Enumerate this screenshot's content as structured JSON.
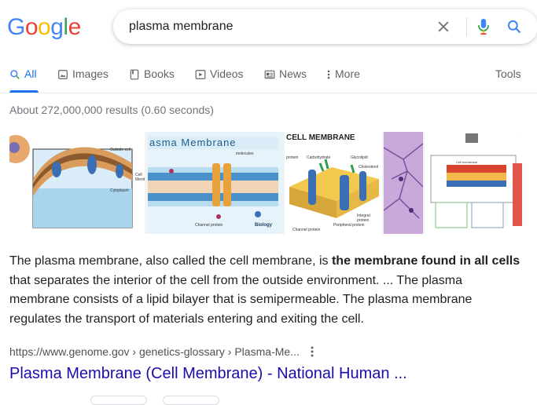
{
  "logo": {
    "letters": [
      "G",
      "o",
      "o",
      "g",
      "l",
      "e"
    ],
    "colors": [
      "#4285F4",
      "#EA4335",
      "#FBBC05",
      "#4285F4",
      "#34A853",
      "#EA4335"
    ]
  },
  "search": {
    "query": "plasma membrane"
  },
  "tabs": [
    {
      "label": "All",
      "icon": "search-icon",
      "active": true
    },
    {
      "label": "Images",
      "icon": "image-icon"
    },
    {
      "label": "Books",
      "icon": "book-icon"
    },
    {
      "label": "Videos",
      "icon": "video-play-icon"
    },
    {
      "label": "News",
      "icon": "news-icon"
    },
    {
      "label": "More",
      "icon": "more-dots-icon"
    },
    {
      "label": "Tools"
    }
  ],
  "stats": "About 272,000,000 results (0.60 seconds)",
  "images": [
    {
      "caption": "",
      "labels": [
        "Outside cell",
        "Cell Memb",
        "Cytoplasm"
      ]
    },
    {
      "caption": "asma Membrane",
      "labels": [
        "molecules",
        "Channel protein",
        "Biology"
      ]
    },
    {
      "caption": "CELL MEMBRANE",
      "labels": [
        "protein",
        "Carbohydrate",
        "Glycolipid",
        "Cholesterol",
        "Integral protein",
        "Channel protein",
        "Peripheral protein"
      ]
    },
    {
      "caption": "",
      "labels": []
    },
    {
      "caption": "",
      "labels": [
        "Cell membrane"
      ]
    }
  ],
  "snippet": {
    "part1": "The plasma membrane, also called the cell membrane, is ",
    "bold": "the membrane found in all cells",
    "part2": " that separates the interior of the cell from the outside environment. ... The plasma membrane consists of a lipid bilayer that is semipermeable. The plasma membrane regulates the transport of materials entering and exiting the cell."
  },
  "result": {
    "url": "https://www.genome.gov › genetics-glossary › Plasma-Me...",
    "title": "Plasma Membrane (Cell Membrane) - National Human ..."
  },
  "colors": {
    "accent": "#1a73e8",
    "link": "#1a0dab",
    "muted": "#70757a"
  }
}
